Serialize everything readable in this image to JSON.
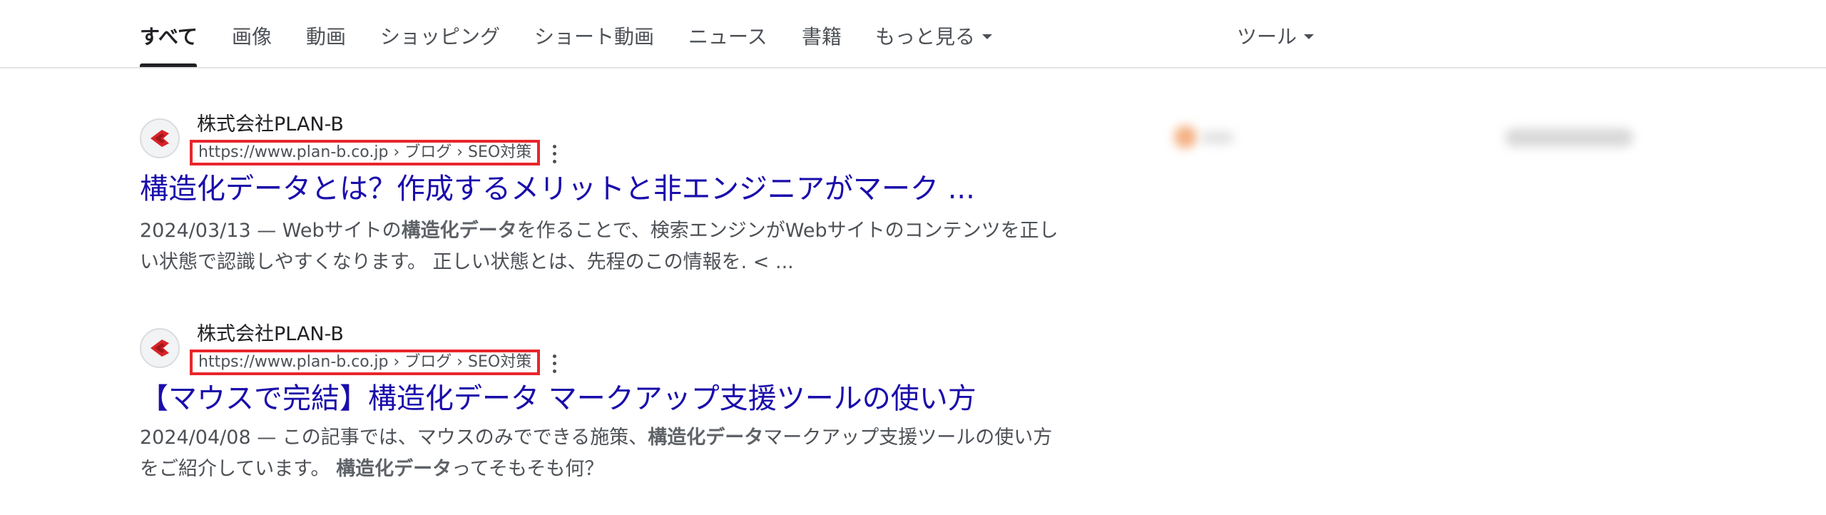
{
  "tabs": [
    {
      "label": "すべて",
      "active": true
    },
    {
      "label": "画像"
    },
    {
      "label": "動画"
    },
    {
      "label": "ショッピング"
    },
    {
      "label": "ショート動画"
    },
    {
      "label": "ニュース"
    },
    {
      "label": "書籍"
    },
    {
      "label": "もっと見る"
    }
  ],
  "tools_label": "ツール",
  "results": [
    {
      "site_name": "株式会社PLAN-B",
      "url": "https://www.plan-b.co.jp › ブログ › SEO対策",
      "title": "構造化データとは？作成するメリットと非エンジニアがマーク ...",
      "date": "2024/03/13",
      "separator": " — ",
      "snippet_line1_a": "Webサイトの",
      "snippet_line1_bold": "構造化データ",
      "snippet_line1_b": "を作ることで、検索エンジンがWebサイトのコンテンツを正し",
      "snippet_line2": "い状態で認識しやすくなります。 正しい状態とは、先程のこの情報を. < ..."
    },
    {
      "site_name": "株式会社PLAN-B",
      "url": "https://www.plan-b.co.jp › ブログ › SEO対策",
      "title": "【マウスで完結】構造化データ マークアップ支援ツールの使い方",
      "date": "2024/04/08",
      "separator": " — ",
      "snippet_line1_a": "この記事では、マウスのみでできる施策、",
      "snippet_line1_bold": "構造化データ",
      "snippet_line1_b": "マークアップ支援ツールの使い方",
      "snippet_line2_a": "をご紹介しています。 ",
      "snippet_line2_bold": "構造化データ",
      "snippet_line2_b": "ってそもそも何？"
    }
  ],
  "colors": {
    "link": "#1a0dab",
    "highlight_box": "#e8262b",
    "favicon_red": "#d8232a"
  }
}
